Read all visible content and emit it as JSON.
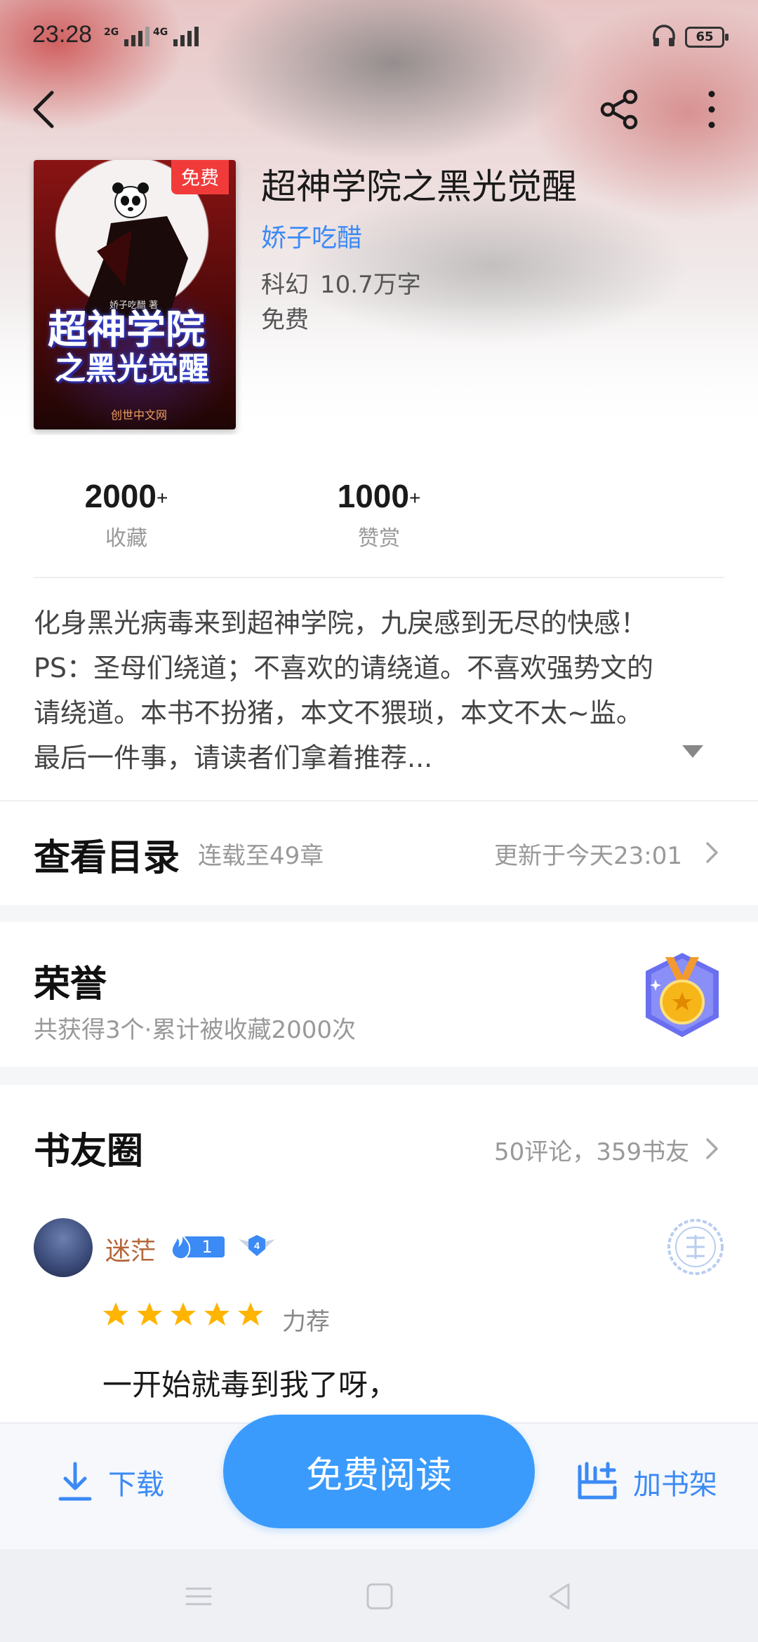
{
  "status_bar": {
    "time": "23:28",
    "net1": "2G",
    "net2": "4G",
    "battery": "65"
  },
  "book": {
    "title": "超神学院之黑光觉醒",
    "author": "娇子吃醋",
    "genre": "科幻",
    "word_count": "10.7万字",
    "price": "免费",
    "cover": {
      "badge": "免费",
      "author_mini": "娇子吃醋 著",
      "title_line1": "超神学院",
      "title_line2": "之黑光觉醒",
      "publisher": "创世中文网"
    }
  },
  "stats": [
    {
      "value": "2000",
      "suffix": "+",
      "label": "收藏"
    },
    {
      "value": "1000",
      "suffix": "+",
      "label": "赞赏"
    }
  ],
  "synopsis": [
    "化身黑光病毒来到超神学院，九戾感到无尽的快感！",
    "PS：圣母们绕道；不喜欢的请绕道。不喜欢强势文的",
    "请绕道。本书不扮猪，本文不猥琐，本文不太~监。",
    "最后一件事，请读者们拿着推荐..."
  ],
  "toc": {
    "title": "查看目录",
    "progress": "连载至49章",
    "updated": "更新于今天23:01"
  },
  "honor": {
    "title": "荣誉",
    "summary": "共获得3个·累计被收藏2000次"
  },
  "circle": {
    "title": "书友圈",
    "count": "50评论，359书友",
    "comment": {
      "user": "迷茫",
      "fire_level": "1",
      "wing_level": "4",
      "rating": 5,
      "rating_label": "力荐",
      "text": "一开始就毒到我了呀，"
    }
  },
  "actions": {
    "download": "下载",
    "read": "免费阅读",
    "add_shelf": "加书架"
  },
  "colors": {
    "accent": "#3a9bfd",
    "link": "#3b8af5",
    "badge_red": "#f13b3b",
    "star": "#ffb400"
  }
}
